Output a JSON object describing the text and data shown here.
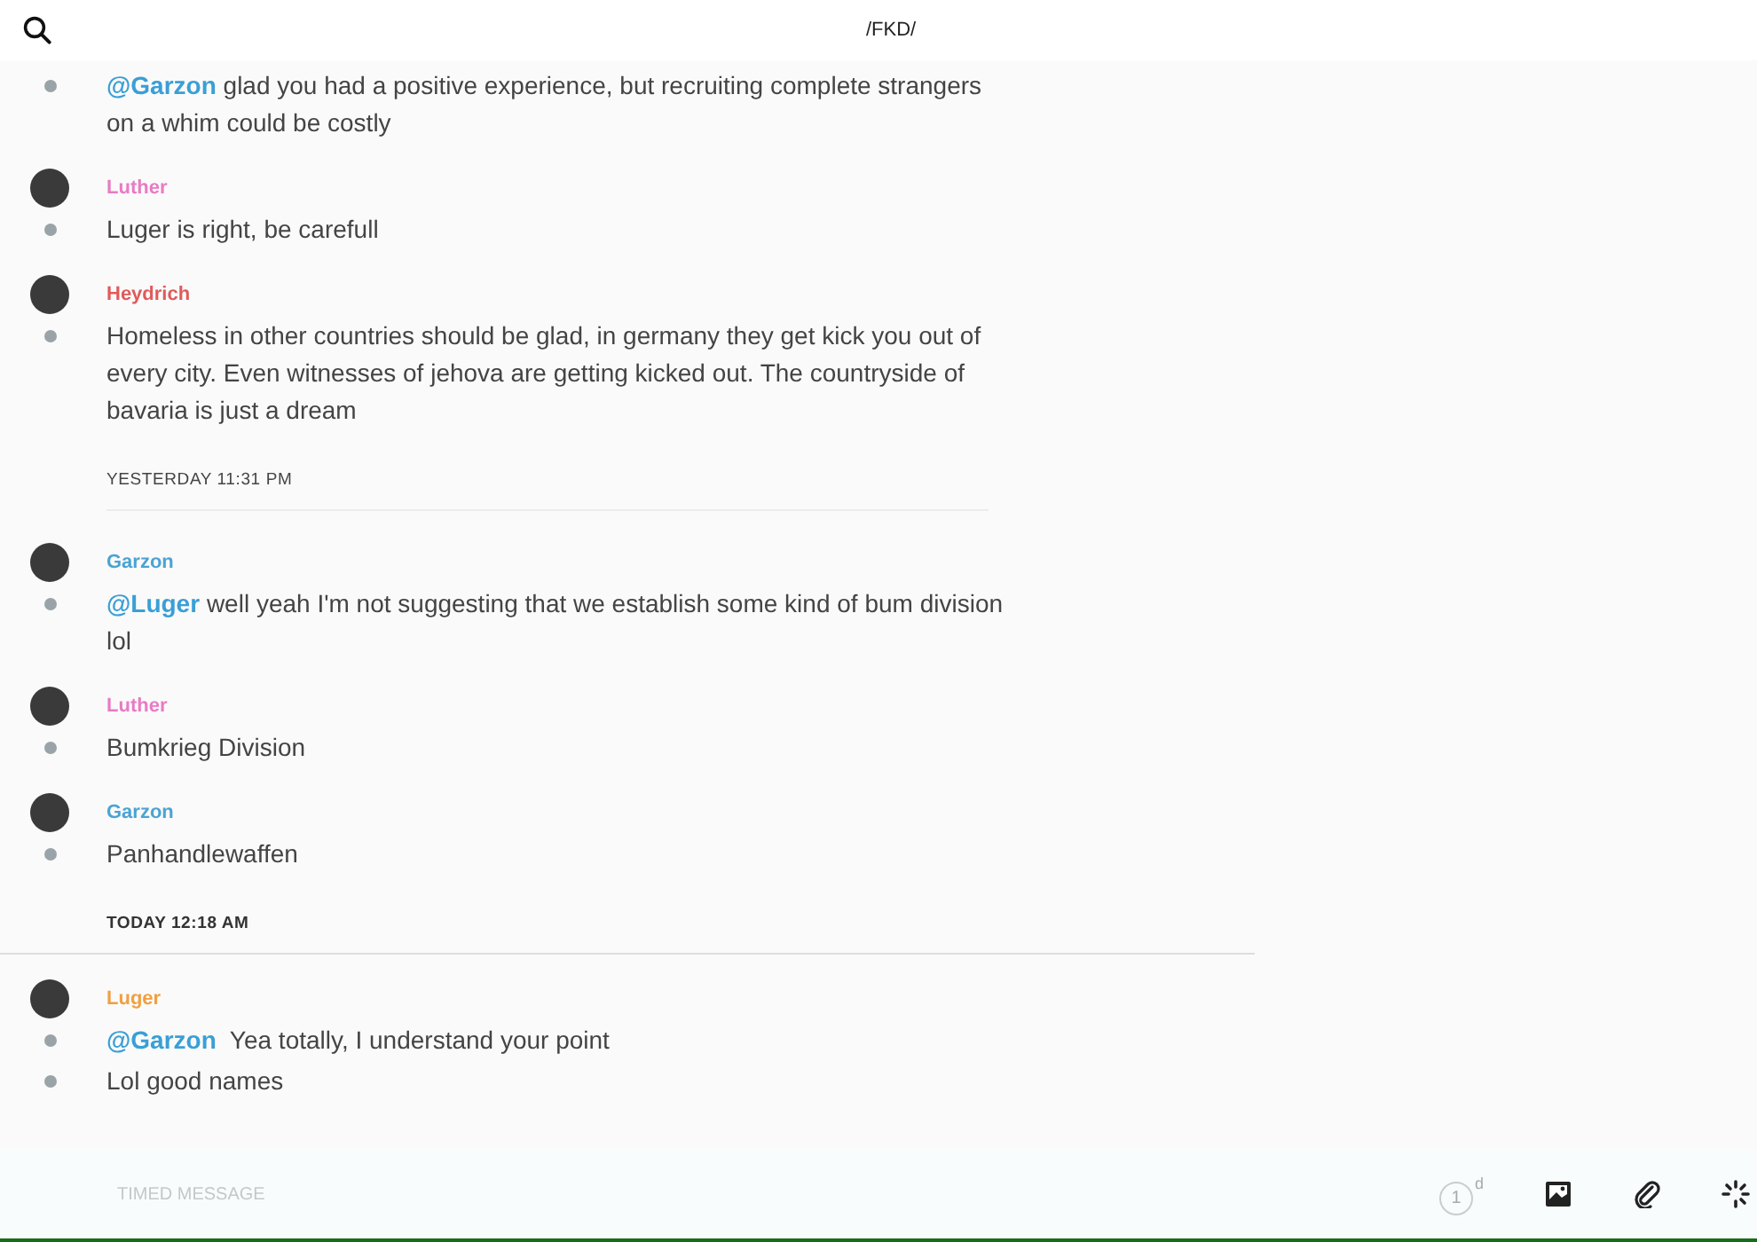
{
  "header": {
    "title": "/FKD/"
  },
  "feed": [
    {
      "kind": "continuation",
      "messages": [
        {
          "mention": "@Garzon",
          "text": "glad you had a positive experience, but recruiting complete strangers    on a whim could be costly"
        }
      ]
    },
    {
      "kind": "group",
      "author": "Luther",
      "color": "#e87bc4",
      "messages": [
        {
          "text": "Luger is right, be carefull"
        }
      ]
    },
    {
      "kind": "group",
      "author": "Heydrich",
      "color": "#e05a5a",
      "messages": [
        {
          "text": "Homeless in other countries should be glad, in germany they get kick you out of every city. Even witnesses of jehova are getting kicked out. The countryside of bavaria is just a dream"
        }
      ]
    },
    {
      "kind": "divider",
      "label": "YESTERDAY 11:31 PM"
    },
    {
      "kind": "group",
      "author": "Garzon",
      "color": "#4aa3d4",
      "messages": [
        {
          "mention": "@Luger",
          "text": "well yeah I'm not suggesting that we establish some kind of bum division lol"
        }
      ]
    },
    {
      "kind": "group",
      "author": "Luther",
      "color": "#e87bc4",
      "messages": [
        {
          "text": "Bumkrieg Division"
        }
      ]
    },
    {
      "kind": "group",
      "author": "Garzon",
      "color": "#4aa3d4",
      "messages": [
        {
          "text": "Panhandlewaffen"
        }
      ]
    },
    {
      "kind": "divider",
      "label": "TODAY 12:18 AM",
      "wide": true
    },
    {
      "kind": "group",
      "author": "Luger",
      "color": "#f0a040",
      "messages": [
        {
          "mention": "@Garzon",
          "text": " Yea totally, I understand your point"
        },
        {
          "text": "Lol good names"
        }
      ]
    }
  ],
  "composer": {
    "placeholder": "TIMED MESSAGE",
    "timer": "1",
    "timer_unit": "d"
  }
}
